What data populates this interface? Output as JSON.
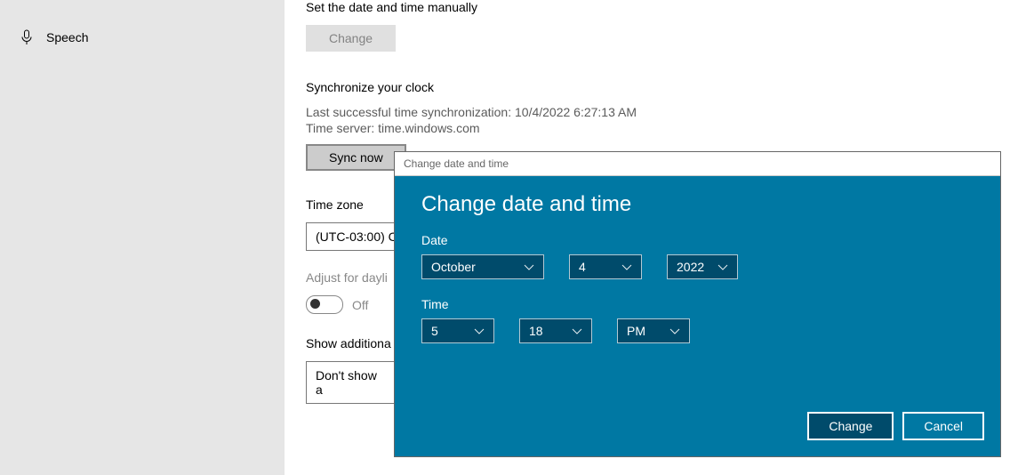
{
  "sidebar": {
    "items": [
      {
        "label": "Speech",
        "icon": "speech"
      }
    ]
  },
  "main": {
    "manual": {
      "heading": "Set the date and time manually",
      "change_btn": "Change"
    },
    "sync": {
      "heading": "Synchronize your clock",
      "last_sync": "Last successful time synchronization: 10/4/2022 6:27:13 AM",
      "server": "Time server: time.windows.com",
      "sync_btn": "Sync now"
    },
    "timezone": {
      "heading": "Time zone",
      "value": "(UTC-03:00) C"
    },
    "dst": {
      "heading": "Adjust for dayli",
      "state": "Off"
    },
    "additional": {
      "heading": "Show additiona",
      "value": "Don't show a"
    }
  },
  "dialog": {
    "titlebar": "Change date and time",
    "heading": "Change date and time",
    "date_label": "Date",
    "month": "October",
    "day": "4",
    "year": "2022",
    "time_label": "Time",
    "hour": "5",
    "minute": "18",
    "ampm": "PM",
    "change_btn": "Change",
    "cancel_btn": "Cancel"
  }
}
